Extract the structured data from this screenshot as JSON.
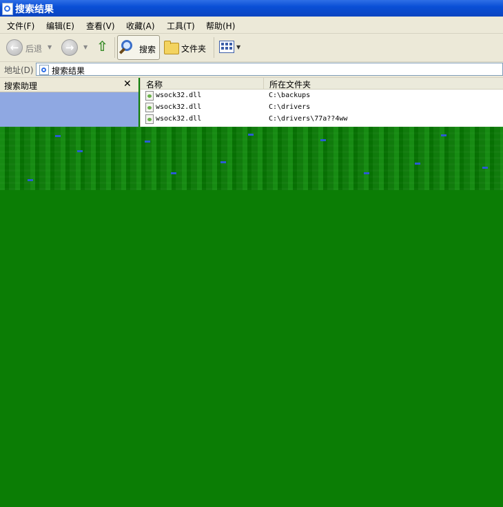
{
  "window": {
    "title": "搜索结果"
  },
  "menu": {
    "items": [
      {
        "label": "文件(F)"
      },
      {
        "label": "编辑(E)"
      },
      {
        "label": "查看(V)"
      },
      {
        "label": "收藏(A)"
      },
      {
        "label": "工具(T)"
      },
      {
        "label": "帮助(H)"
      }
    ]
  },
  "toolbar": {
    "back_label": "后退",
    "search_label": "搜索",
    "folders_label": "文件夹"
  },
  "address": {
    "label": "地址(D)",
    "value": "搜索结果"
  },
  "search_pane": {
    "title": "搜索助理",
    "close_symbol": "✕"
  },
  "results": {
    "columns": [
      {
        "label": "名称"
      },
      {
        "label": "所在文件夹"
      }
    ],
    "rows": [
      {
        "name": "wsock32.dll",
        "folder": "C:\\backups"
      },
      {
        "name": "wsock32.dll",
        "folder": "C:\\drivers"
      },
      {
        "name": "wsock32.dll",
        "folder": "C:\\drivers\\77a??4ww"
      }
    ]
  },
  "colors": {
    "titlebar": "#0a4fd6",
    "chrome": "#ece9d8",
    "pane_blue": "#8fa8e2",
    "glitch_green": "#0b7d05"
  }
}
